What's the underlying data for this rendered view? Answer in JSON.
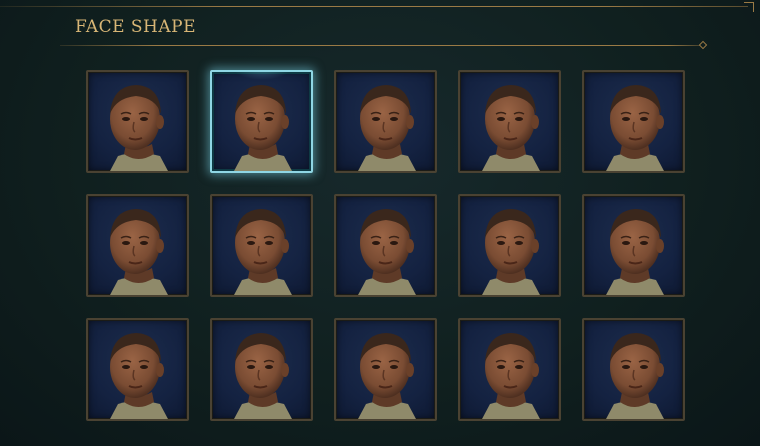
{
  "section": {
    "title": "FACE SHAPE"
  },
  "selected_index": 1,
  "colors": {
    "accent_gold": "#d8b676",
    "selection_glow": "#8fd6e4",
    "tile_background": "#142241",
    "skin": "#7a4c33",
    "hair": "#3a271c",
    "collar": "#8f8a6a"
  },
  "tiles": [
    {
      "icon": "face-portrait-icon"
    },
    {
      "icon": "face-portrait-icon"
    },
    {
      "icon": "face-portrait-icon"
    },
    {
      "icon": "face-portrait-icon"
    },
    {
      "icon": "face-portrait-icon"
    },
    {
      "icon": "face-portrait-icon"
    },
    {
      "icon": "face-portrait-icon"
    },
    {
      "icon": "face-portrait-icon"
    },
    {
      "icon": "face-portrait-icon"
    },
    {
      "icon": "face-portrait-icon"
    },
    {
      "icon": "face-portrait-icon"
    },
    {
      "icon": "face-portrait-icon"
    },
    {
      "icon": "face-portrait-icon"
    },
    {
      "icon": "face-portrait-icon"
    },
    {
      "icon": "face-portrait-icon"
    }
  ]
}
